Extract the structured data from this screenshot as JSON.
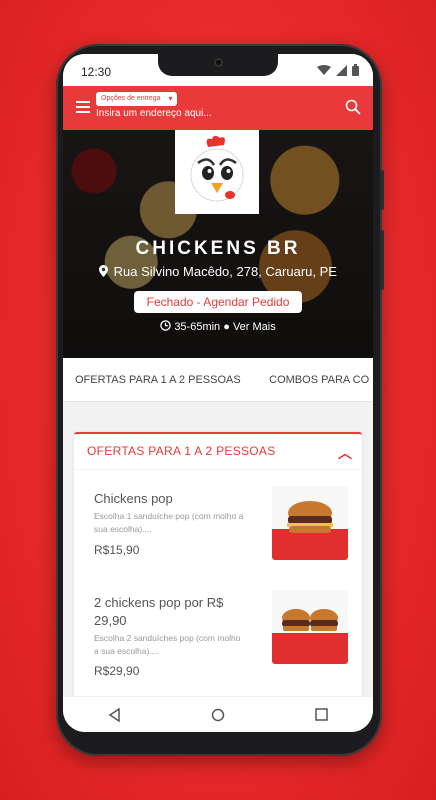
{
  "status_bar": {
    "time": "12:30"
  },
  "header": {
    "delivery_option": "Opções de entrega",
    "address_placeholder": "Insira um endereço aqui..."
  },
  "store": {
    "name": "CHICKENS BR",
    "address": "Rua Silvino Macêdo, 278, Caruaru, PE",
    "status_button": "Fechado - Agendar Pedido",
    "delivery_time": "35-65min",
    "more_info": "Ver Mais"
  },
  "tabs": [
    {
      "label": "OFERTAS PARA 1 A 2 PESSOAS"
    },
    {
      "label": "COMBOS PARA CO"
    }
  ],
  "section": {
    "title": "OFERTAS PARA 1 A 2 PESSOAS",
    "products": [
      {
        "name": "Chickens pop",
        "description": "Escolha 1 sanduíche pop (com molho a sua escolha)....",
        "price": "R$15,90"
      },
      {
        "name": "2 chickens pop por R$ 29,90",
        "description": "Escolha 2 sanduíches pop (com molho a sua escolha)....",
        "price": "R$29,90"
      }
    ]
  },
  "colors": {
    "brand": "#e83a3a",
    "background": "#e82a2a"
  },
  "icons": [
    "menu-icon",
    "search-icon",
    "map-marker-icon",
    "clock-icon",
    "chevron-up-icon",
    "back-icon",
    "home-icon",
    "recents-icon"
  ]
}
